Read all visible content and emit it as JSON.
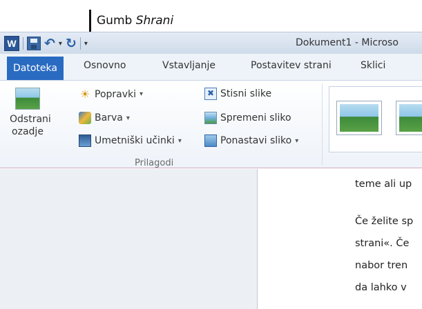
{
  "callout": {
    "prefix": "Gumb ",
    "emphasis": "Shrani"
  },
  "titlebar": {
    "word_icon": "W",
    "title": "Dokument1 - Microso"
  },
  "tabs": {
    "file": "Datoteka",
    "items": [
      "Osnovno",
      "Vstavljanje",
      "Postavitev strani",
      "Sklici"
    ]
  },
  "ribbon": {
    "remove_bg": {
      "line1": "Odstrani",
      "line2": "ozadje"
    },
    "corrections": "Popravki",
    "color": "Barva",
    "effects": "Umetniški učinki",
    "compress": "Stisni slike",
    "change": "Spremeni sliko",
    "reset": "Ponastavi sliko",
    "group_label": "Prilagodi"
  },
  "document": {
    "lines": [
      "teme ali up",
      "Če želite sp",
      "strani«. Če",
      "nabor tren",
      "da lahko v"
    ]
  },
  "icons": [
    "word-icon",
    "save-icon",
    "undo-icon",
    "redo-icon",
    "remove-background-icon",
    "corrections-icon",
    "color-icon",
    "artistic-effects-icon",
    "compress-icon",
    "change-picture-icon",
    "reset-picture-icon"
  ]
}
